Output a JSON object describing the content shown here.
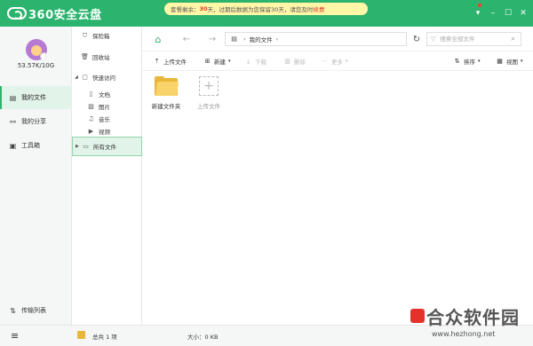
{
  "app": {
    "title": "360安全云盘"
  },
  "notice": {
    "prefix": "套餐剩余：",
    "days": "30",
    "middle": "天，过期后数据为您保留30天，请您及时",
    "link": "续费"
  },
  "window_controls": {
    "settings": "▾",
    "minimize": "–",
    "maximize": "☐",
    "close": "✕"
  },
  "sidebar": {
    "quota": "53.57K/10G",
    "items": [
      {
        "label": "我的文件",
        "icon": "files-icon"
      },
      {
        "label": "我的分享",
        "icon": "share-icon"
      },
      {
        "label": "工具箱",
        "icon": "toolbox-icon"
      }
    ],
    "transfer_label": "传输列表"
  },
  "tree": {
    "items": [
      {
        "label": "保险箱",
        "icon": "safe-icon"
      },
      {
        "label": "回收站",
        "icon": "recycle-icon"
      },
      {
        "label": "快速访问",
        "icon": "quick-access-icon"
      },
      {
        "label": "文档",
        "icon": "document-icon"
      },
      {
        "label": "图片",
        "icon": "image-icon"
      },
      {
        "label": "音乐",
        "icon": "music-icon"
      },
      {
        "label": "视频",
        "icon": "video-icon"
      },
      {
        "label": "所有文件",
        "icon": "folder-icon"
      }
    ]
  },
  "addressbar": {
    "path_root": "我的文件",
    "search_placeholder": "搜索全部文件"
  },
  "toolbar": {
    "upload": "上传文件",
    "new": "新建",
    "download": "下载",
    "delete": "删除",
    "more": "更多",
    "sort": "排序",
    "view": "视图"
  },
  "content": {
    "items": [
      {
        "label": "新建文件夹"
      },
      {
        "label": "上传文件"
      }
    ]
  },
  "statusbar": {
    "count": "总共 1 项",
    "size": "大小：0 KB"
  },
  "watermark": {
    "title": "合众软件园",
    "url": "www.hezhong.net"
  },
  "colors": {
    "brand": "#2cb46e",
    "notice_bg": "#fff6a8",
    "folder": "#e8b63a"
  }
}
